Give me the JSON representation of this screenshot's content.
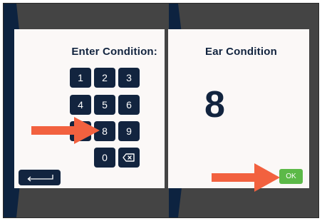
{
  "left_panel": {
    "title": "Enter Condition:",
    "keys": [
      "1",
      "2",
      "3",
      "4",
      "5",
      "6",
      "7",
      "8",
      "9",
      "0"
    ]
  },
  "right_panel": {
    "title": "Ear Condition",
    "value": "8",
    "ok_label": "OK"
  },
  "colors": {
    "navy": "#12243f",
    "arrow": "#f2613f",
    "ok_green": "#5cb948",
    "bezel": "#444444"
  },
  "icons": [
    "backspace-icon",
    "return-arrow-icon",
    "pointer-arrow-icon"
  ]
}
